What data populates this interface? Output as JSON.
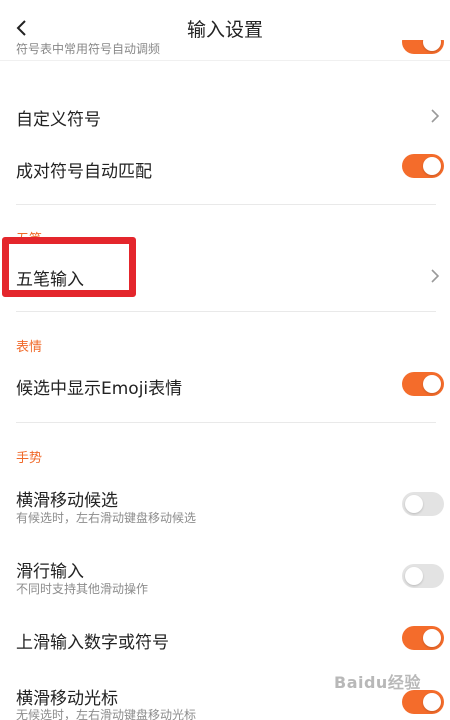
{
  "header": {
    "title": "输入设置"
  },
  "clipped": {
    "subtitle": "符号表中常用符号自动调频",
    "toggle": "on"
  },
  "rows_symbols": [
    {
      "label": "自定义符号"
    },
    {
      "label": "成对符号自动匹配",
      "toggle": "on"
    }
  ],
  "section_wubi": {
    "label": "五笔",
    "row": {
      "label": "五笔输入"
    }
  },
  "section_emoji": {
    "label": "表情",
    "row": {
      "label": "候选中显示Emoji表情",
      "toggle": "on"
    }
  },
  "section_gesture": {
    "label": "手势",
    "rows": [
      {
        "label": "横滑移动候选",
        "subtitle": "有候选时，左右滑动键盘移动候选",
        "toggle": "off"
      },
      {
        "label": "滑行输入",
        "subtitle": "不同时支持其他滑动操作",
        "toggle": "off"
      },
      {
        "label": "上滑输入数字或符号",
        "toggle": "on"
      },
      {
        "label": "横滑移动光标",
        "subtitle": "无候选时，左右滑动键盘移动光标",
        "toggle": "on"
      }
    ]
  },
  "watermark": "Baidu经验",
  "colors": {
    "accent": "#f46c2b",
    "section": "#f06a2a",
    "highlight": "#e4262c"
  }
}
